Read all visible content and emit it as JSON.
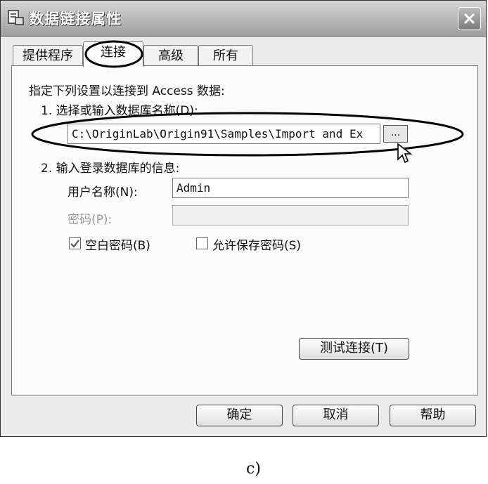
{
  "window": {
    "title": "数据链接属性",
    "icon": "data-link-icon",
    "close_icon": "close-icon"
  },
  "tabs": [
    {
      "label": "提供程序",
      "active": false
    },
    {
      "label": "连接",
      "active": true
    },
    {
      "label": "高级",
      "active": false
    },
    {
      "label": "所有",
      "active": false
    }
  ],
  "connection": {
    "intro": "指定下列设置以连接到 Access 数据:",
    "step1_label": "1. 选择或输入数据库名称(D):",
    "database_path": "C:\\OriginLab\\Origin91\\Samples\\Import and Ex",
    "browse_label": "...",
    "step2_label": "2. 输入登录数据库的信息:",
    "username_label": "用户名称(N):",
    "username_value": "Admin",
    "password_label": "密码(P):",
    "password_value": "",
    "blank_password_label": "空白密码(B)",
    "blank_password_checked": true,
    "save_password_label": "允许保存密码(S)",
    "save_password_checked": false,
    "test_button": "测试连接(T)"
  },
  "footer": {
    "ok": "确定",
    "cancel": "取消",
    "help": "帮助"
  },
  "caption": "c)"
}
